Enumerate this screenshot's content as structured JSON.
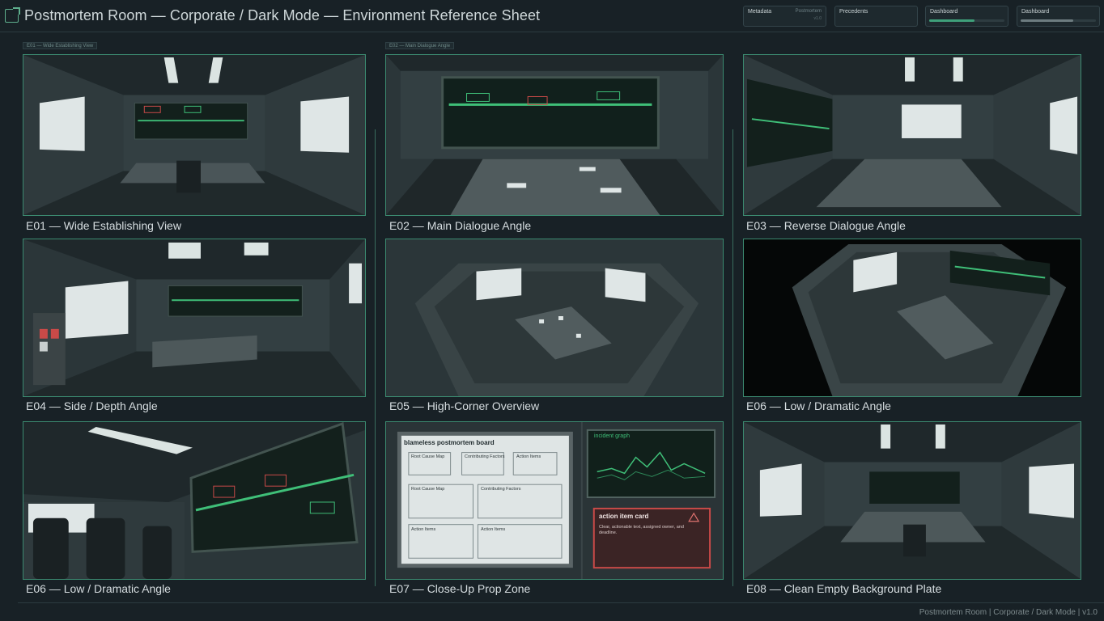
{
  "header": {
    "title": "Postmortem Room — Corporate / Dark Mode — Environment Reference Sheet",
    "chips": [
      {
        "label": "Metadata",
        "right": "Postmortem",
        "sub": "v1.0"
      },
      {
        "label": "Precedents",
        "right": "",
        "sub": ""
      },
      {
        "label": "Dashboard",
        "progress": 0.6,
        "color": "#3fa07a"
      },
      {
        "label": "Dashboard",
        "progress": 0.7,
        "color": "#6d7c80"
      }
    ]
  },
  "section_tags": {
    "left": "E01 — Wide Establishing View",
    "middle": "E02 — Main Dialogue Angle"
  },
  "panels": [
    {
      "caption": "E01 — Wide Establishing View"
    },
    {
      "caption": "E02 — Main Dialogue Angle"
    },
    {
      "caption": "E03 — Reverse Dialogue Angle"
    },
    {
      "caption": "E04 — Side / Depth Angle"
    },
    {
      "caption": "E05 — High-Corner Overview"
    },
    {
      "caption": "E06 — Low / Dramatic Angle"
    },
    {
      "caption": "E06 — Low / Dramatic Angle"
    },
    {
      "caption": "E07 — Close-Up Prop Zone"
    },
    {
      "caption": "E08 — Clean Empty Background Plate"
    }
  ],
  "props": {
    "board_title": "blameless postmortem board",
    "board_boxes": [
      "Root Cause Map",
      "Contributing Factors",
      "Action Items",
      "Root Cause Map",
      "Contributing Factors",
      "Action Items",
      "Action Items"
    ],
    "graph_title": "incident graph",
    "card_title": "action item card",
    "card_text": "Clear, actionable text, assigned owner, and deadline."
  },
  "footer": "Postmortem Room | Corporate / Dark Mode | v1.0",
  "colors": {
    "accent": "#3b8a70",
    "screen_green": "#3fbf78",
    "alert_red": "#c94a48",
    "background": "#182126"
  }
}
